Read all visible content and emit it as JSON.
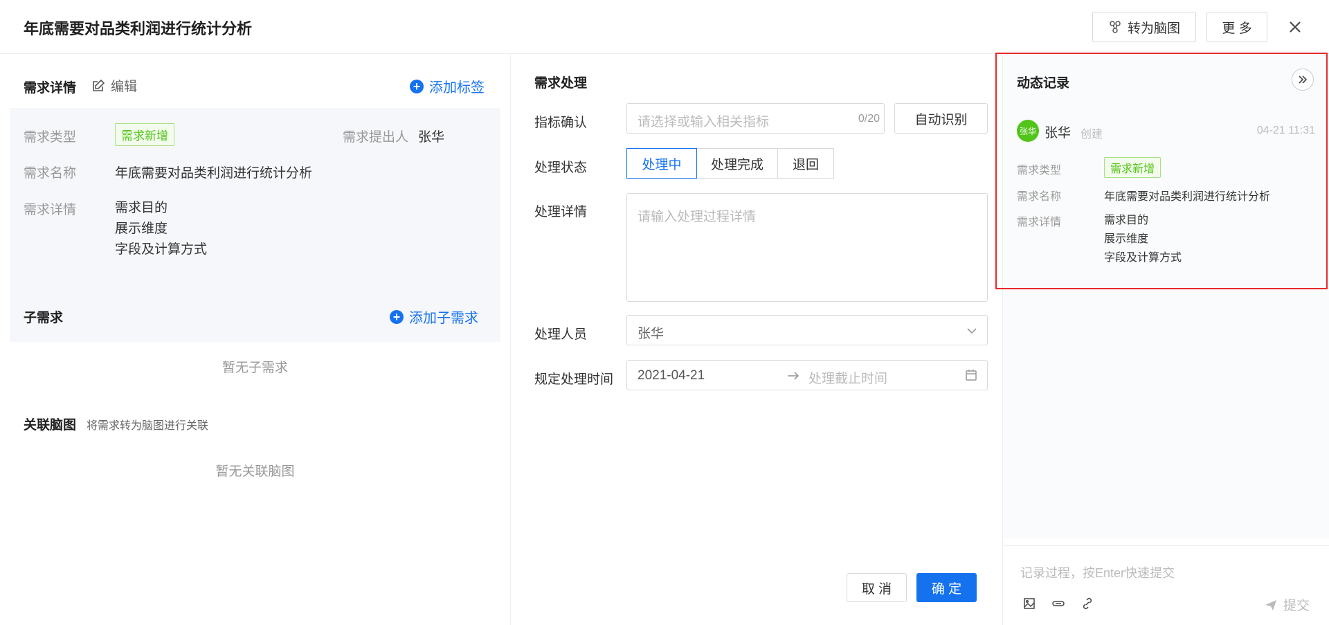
{
  "dialog": {
    "title": "年底需要对品类利润进行统计分析",
    "mindmap_label": "转为脑图",
    "more_label": "更 多",
    "close_label": "×"
  },
  "details": {
    "title": "需求详情",
    "edit_label": "编辑",
    "add_tag_label": "添加标签",
    "type_label": "需求类型",
    "type_value": "需求新增",
    "proposer_label": "需求提出人",
    "proposer_value": "张华",
    "name_label": "需求名称",
    "name_value": "年底需要对品类利润进行统计分析",
    "detail_label": "需求详情",
    "detail_lines": [
      "需求目的",
      "展示维度",
      "字段及计算方式"
    ]
  },
  "sub": {
    "title": "子需求",
    "add_label": "添加子需求",
    "empty": "暂无子需求"
  },
  "mindmap": {
    "title": "关联脑图",
    "hint": "将需求转为脑图进行关联",
    "empty": "暂无关联脑图"
  },
  "process": {
    "title": "需求处理",
    "metric_label": "指标确认",
    "metric_placeholder": "请选择或输入相关指标",
    "metric_count": "0/20",
    "auto_label": "自动识别",
    "status_label": "处理状态",
    "status_options": [
      "处理中",
      "处理完成",
      "退回"
    ],
    "detail_label": "处理详情",
    "detail_placeholder": "请输入处理过程详情",
    "person_label": "处理人员",
    "person_value": "张华",
    "time_label": "规定处理时间",
    "time_start": "2021-04-21",
    "time_end_placeholder": "处理截止时间",
    "cancel_label": "取 消",
    "confirm_label": "确 定"
  },
  "activity": {
    "title": "动态记录",
    "avatar_text": "张华",
    "user": "张华",
    "action": "创建",
    "time": "04-21 11:31",
    "type_label": "需求类型",
    "type_value": "需求新增",
    "name_label": "需求名称",
    "name_value": "年底需要对品类利润进行统计分析",
    "detail_label": "需求详情",
    "detail_lines": [
      "需求目的",
      "展示维度",
      "字段及计算方式"
    ],
    "input_placeholder": "记录过程，按Enter快速提交",
    "submit_label": "提交"
  },
  "colors": {
    "primary": "#1572ef",
    "tag_green": "#52c41a",
    "avatar_green": "#52c41a",
    "highlight_red": "#e82a2a"
  }
}
